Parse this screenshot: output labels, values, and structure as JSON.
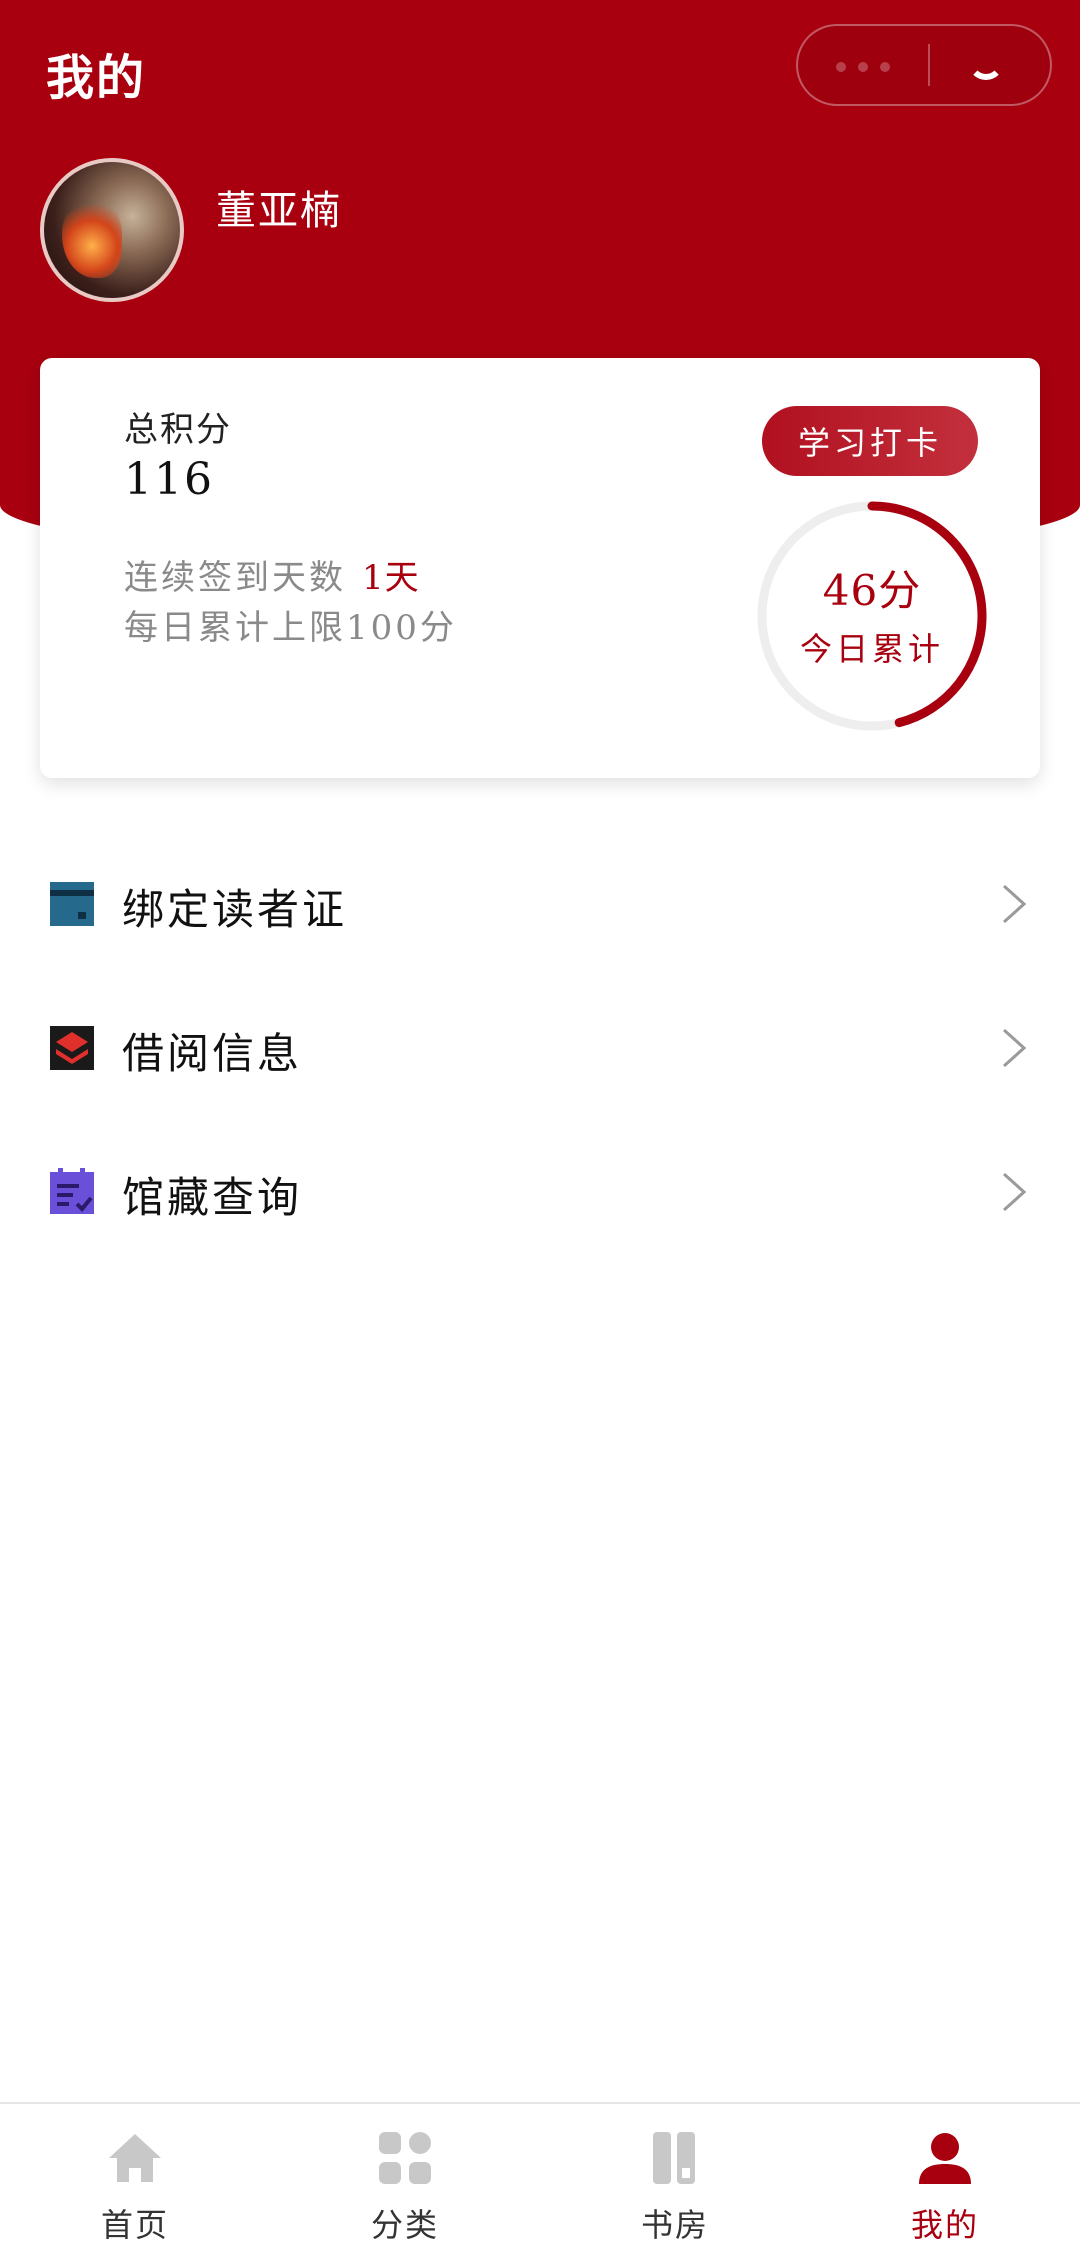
{
  "header": {
    "title": "我的",
    "user": {
      "name": "董亚楠"
    }
  },
  "points_card": {
    "total_label": "总积分",
    "total_value": "116",
    "streak_label": "连续签到天数",
    "streak_value": "1天",
    "daily_limit": "每日累计上限100分",
    "checkin_button": "学习打卡",
    "today_score": "46分",
    "today_label": "今日累计",
    "today_progress": 0.46
  },
  "menu": [
    {
      "label": "绑定读者证",
      "icon": "reader-card-icon"
    },
    {
      "label": "借阅信息",
      "icon": "borrow-layers-icon"
    },
    {
      "label": "馆藏查询",
      "icon": "collection-search-icon"
    }
  ],
  "tabbar": [
    {
      "label": "首页",
      "icon": "home-icon",
      "active": false
    },
    {
      "label": "分类",
      "icon": "category-icon",
      "active": false
    },
    {
      "label": "书房",
      "icon": "bookshelf-icon",
      "active": false
    },
    {
      "label": "我的",
      "icon": "user-icon",
      "active": true
    }
  ],
  "colors": {
    "primary": "#a8000f",
    "inactive_icon": "#c8c8c8",
    "ring_track": "#eeeeee"
  }
}
